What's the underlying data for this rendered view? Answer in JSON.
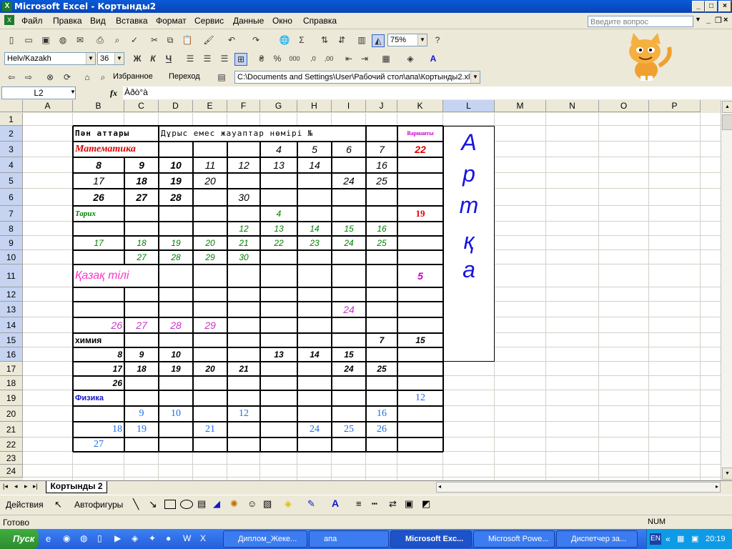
{
  "window": {
    "title": "Microsoft Excel - Кортынды2",
    "app_icon": "excel-icon"
  },
  "menu": [
    "Файл",
    "Правка",
    "Вид",
    "Вставка",
    "Формат",
    "Сервис",
    "Данные",
    "Окно",
    "Справка"
  ],
  "help_box": {
    "placeholder": "Введите вопрос"
  },
  "toolbar": {
    "zoom": "75%"
  },
  "format_toolbar": {
    "font": "Helv/Kazakh",
    "size": "36",
    "bold": "Ж",
    "italic": "К",
    "underline": "Ч"
  },
  "web_toolbar": {
    "favorites": "Избранное",
    "go": "Переход",
    "address": "C:\\Documents and Settings\\User\\Рабочий стол\\апа\\Кортынды2.xls"
  },
  "formula_bar": {
    "name_box": "L2",
    "fx": "fx",
    "content": "Àðò°à"
  },
  "columns": [
    "A",
    "B",
    "C",
    "D",
    "E",
    "F",
    "G",
    "H",
    "I",
    "J",
    "K",
    "L",
    "M",
    "N",
    "O",
    "P"
  ],
  "rows": [
    "1",
    "2",
    "3",
    "4",
    "5",
    "6",
    "7",
    "8",
    "9",
    "10",
    "11",
    "12",
    "13",
    "14",
    "15",
    "16",
    "17",
    "18",
    "19",
    "20",
    "21",
    "22",
    "23",
    "24"
  ],
  "cells": [
    {
      "r": 2,
      "c": "B",
      "t": "Пән аттары",
      "color": "#000000",
      "bold": true,
      "align": "left",
      "font": "mono",
      "size": 11
    },
    {
      "r": 2,
      "c": "D",
      "t": "Дұрыс емес жауаптар нөмірі №",
      "color": "#000000",
      "bold": false,
      "align": "left",
      "font": "mono",
      "size": 11
    },
    {
      "r": 2,
      "c": "K",
      "t": "Варианты",
      "color": "#cc00cc",
      "bold": true,
      "align": "center",
      "font": "serif",
      "size": 8
    },
    {
      "r": 3,
      "c": "B",
      "t": "Математика",
      "color": "#e00000",
      "bold": true,
      "align": "left",
      "font": "serif",
      "italic": true,
      "size": 14
    },
    {
      "r": 3,
      "c": "G",
      "t": "4",
      "color": "#000000",
      "align": "center",
      "italic": true,
      "size": 14
    },
    {
      "r": 3,
      "c": "H",
      "t": "5",
      "color": "#000000",
      "align": "center",
      "italic": true,
      "size": 14
    },
    {
      "r": 3,
      "c": "I",
      "t": "6",
      "color": "#000000",
      "align": "center",
      "italic": true,
      "size": 14
    },
    {
      "r": 3,
      "c": "J",
      "t": "7",
      "color": "#000000",
      "align": "center",
      "italic": true,
      "size": 14
    },
    {
      "r": 3,
      "c": "K",
      "t": "22",
      "color": "#e00000",
      "bold": true,
      "align": "center",
      "italic": true,
      "size": 14
    },
    {
      "r": 4,
      "c": "B",
      "t": "8",
      "color": "#000000",
      "bold": true,
      "align": "center",
      "italic": true,
      "size": 14
    },
    {
      "r": 4,
      "c": "C",
      "t": "9",
      "color": "#000000",
      "bold": true,
      "align": "center",
      "italic": true,
      "size": 14
    },
    {
      "r": 4,
      "c": "D",
      "t": "10",
      "color": "#000000",
      "bold": true,
      "align": "center",
      "italic": true,
      "size": 14
    },
    {
      "r": 4,
      "c": "E",
      "t": "11",
      "color": "#000000",
      "align": "center",
      "italic": true,
      "size": 14
    },
    {
      "r": 4,
      "c": "F",
      "t": "12",
      "color": "#000000",
      "align": "center",
      "italic": true,
      "size": 14
    },
    {
      "r": 4,
      "c": "G",
      "t": "13",
      "color": "#000000",
      "align": "center",
      "italic": true,
      "size": 14
    },
    {
      "r": 4,
      "c": "H",
      "t": "14",
      "color": "#000000",
      "align": "center",
      "italic": true,
      "size": 14
    },
    {
      "r": 4,
      "c": "J",
      "t": "16",
      "color": "#000000",
      "align": "center",
      "italic": true,
      "size": 14
    },
    {
      "r": 5,
      "c": "B",
      "t": "17",
      "color": "#000000",
      "align": "center",
      "italic": true,
      "size": 14
    },
    {
      "r": 5,
      "c": "C",
      "t": "18",
      "color": "#000000",
      "bold": true,
      "align": "center",
      "italic": true,
      "size": 14
    },
    {
      "r": 5,
      "c": "D",
      "t": "19",
      "color": "#000000",
      "bold": true,
      "align": "center",
      "italic": true,
      "size": 14
    },
    {
      "r": 5,
      "c": "E",
      "t": "20",
      "color": "#000000",
      "align": "center",
      "italic": true,
      "size": 14
    },
    {
      "r": 5,
      "c": "I",
      "t": "24",
      "color": "#000000",
      "align": "center",
      "italic": true,
      "size": 14
    },
    {
      "r": 5,
      "c": "J",
      "t": "25",
      "color": "#000000",
      "align": "center",
      "italic": true,
      "size": 14
    },
    {
      "r": 6,
      "c": "B",
      "t": "26",
      "color": "#000000",
      "bold": true,
      "align": "center",
      "italic": true,
      "size": 14
    },
    {
      "r": 6,
      "c": "C",
      "t": "27",
      "color": "#000000",
      "bold": true,
      "align": "center",
      "italic": true,
      "size": 14
    },
    {
      "r": 6,
      "c": "D",
      "t": "28",
      "color": "#000000",
      "bold": true,
      "align": "center",
      "italic": true,
      "size": 14
    },
    {
      "r": 6,
      "c": "F",
      "t": "30",
      "color": "#000000",
      "align": "center",
      "italic": true,
      "size": 14
    },
    {
      "r": 7,
      "c": "B",
      "t": "Тарих",
      "color": "#008000",
      "bold": true,
      "align": "left",
      "font": "serif",
      "italic": true,
      "size": 11
    },
    {
      "r": 7,
      "c": "G",
      "t": "4",
      "color": "#008000",
      "align": "center",
      "italic": true,
      "size": 12
    },
    {
      "r": 7,
      "c": "K",
      "t": "19",
      "color": "#e00000",
      "bold": true,
      "align": "center",
      "font": "serif",
      "size": 13
    },
    {
      "r": 8,
      "c": "F",
      "t": "12",
      "color": "#008000",
      "align": "center",
      "italic": true,
      "size": 12
    },
    {
      "r": 8,
      "c": "G",
      "t": "13",
      "color": "#008000",
      "align": "center",
      "italic": true,
      "size": 12
    },
    {
      "r": 8,
      "c": "H",
      "t": "14",
      "color": "#008000",
      "align": "center",
      "italic": true,
      "size": 12
    },
    {
      "r": 8,
      "c": "I",
      "t": "15",
      "color": "#008000",
      "align": "center",
      "italic": true,
      "size": 12
    },
    {
      "r": 8,
      "c": "J",
      "t": "16",
      "color": "#008000",
      "align": "center",
      "italic": true,
      "size": 12
    },
    {
      "r": 9,
      "c": "B",
      "t": "17",
      "color": "#008000",
      "align": "center",
      "italic": true,
      "size": 12
    },
    {
      "r": 9,
      "c": "C",
      "t": "18",
      "color": "#008000",
      "align": "center",
      "italic": true,
      "size": 12
    },
    {
      "r": 9,
      "c": "D",
      "t": "19",
      "color": "#008000",
      "align": "center",
      "italic": true,
      "size": 12
    },
    {
      "r": 9,
      "c": "E",
      "t": "20",
      "color": "#008000",
      "align": "center",
      "italic": true,
      "size": 12
    },
    {
      "r": 9,
      "c": "F",
      "t": "21",
      "color": "#008000",
      "align": "center",
      "italic": true,
      "size": 12
    },
    {
      "r": 9,
      "c": "G",
      "t": "22",
      "color": "#008000",
      "align": "center",
      "italic": true,
      "size": 12
    },
    {
      "r": 9,
      "c": "H",
      "t": "23",
      "color": "#008000",
      "align": "center",
      "italic": true,
      "size": 12
    },
    {
      "r": 9,
      "c": "I",
      "t": "24",
      "color": "#008000",
      "align": "center",
      "italic": true,
      "size": 12
    },
    {
      "r": 9,
      "c": "J",
      "t": "25",
      "color": "#008000",
      "align": "center",
      "italic": true,
      "size": 12
    },
    {
      "r": 10,
      "c": "C",
      "t": "27",
      "color": "#008000",
      "align": "center",
      "italic": true,
      "size": 12
    },
    {
      "r": 10,
      "c": "D",
      "t": "28",
      "color": "#008000",
      "align": "center",
      "italic": true,
      "size": 12
    },
    {
      "r": 10,
      "c": "E",
      "t": "29",
      "color": "#008000",
      "align": "center",
      "italic": true,
      "size": 12
    },
    {
      "r": 10,
      "c": "F",
      "t": "30",
      "color": "#008000",
      "align": "center",
      "italic": true,
      "size": 12
    },
    {
      "r": 11,
      "c": "B",
      "t": "Қазақ тілі",
      "color": "#ff33cc",
      "align": "left",
      "italic": true,
      "size": 16
    },
    {
      "r": 11,
      "c": "K",
      "t": "5",
      "color": "#cc00cc",
      "bold": true,
      "align": "center",
      "italic": true,
      "size": 14
    },
    {
      "r": 13,
      "c": "I",
      "t": "24",
      "color": "#cc33cc",
      "align": "center",
      "italic": true,
      "size": 14
    },
    {
      "r": 14,
      "c": "B",
      "t": "26",
      "color": "#cc33cc",
      "align": "right",
      "italic": true,
      "size": 14
    },
    {
      "r": 14,
      "c": "C",
      "t": "27",
      "color": "#cc33cc",
      "align": "center",
      "italic": true,
      "size": 14
    },
    {
      "r": 14,
      "c": "D",
      "t": "28",
      "color": "#cc33cc",
      "align": "center",
      "italic": true,
      "size": 14
    },
    {
      "r": 14,
      "c": "E",
      "t": "29",
      "color": "#cc33cc",
      "align": "center",
      "italic": true,
      "size": 14
    },
    {
      "r": 15,
      "c": "B",
      "t": "химия",
      "color": "#000000",
      "bold": true,
      "align": "left",
      "size": 12
    },
    {
      "r": 15,
      "c": "J",
      "t": "7",
      "color": "#000000",
      "bold": true,
      "align": "center",
      "italic": true,
      "size": 12
    },
    {
      "r": 15,
      "c": "K",
      "t": "15",
      "color": "#000000",
      "bold": true,
      "align": "center",
      "italic": true,
      "size": 12
    },
    {
      "r": 16,
      "c": "B",
      "t": "8",
      "color": "#000000",
      "bold": true,
      "align": "right",
      "italic": true,
      "size": 12
    },
    {
      "r": 16,
      "c": "C",
      "t": "9",
      "color": "#000000",
      "bold": true,
      "align": "center",
      "italic": true,
      "size": 12
    },
    {
      "r": 16,
      "c": "D",
      "t": "10",
      "color": "#000000",
      "bold": true,
      "align": "center",
      "italic": true,
      "size": 12
    },
    {
      "r": 16,
      "c": "G",
      "t": "13",
      "color": "#000000",
      "bold": true,
      "align": "center",
      "italic": true,
      "size": 12
    },
    {
      "r": 16,
      "c": "H",
      "t": "14",
      "color": "#000000",
      "bold": true,
      "align": "center",
      "italic": true,
      "size": 12
    },
    {
      "r": 16,
      "c": "I",
      "t": "15",
      "color": "#000000",
      "bold": true,
      "align": "center",
      "italic": true,
      "size": 12
    },
    {
      "r": 17,
      "c": "B",
      "t": "17",
      "color": "#000000",
      "bold": true,
      "align": "right",
      "italic": true,
      "size": 12
    },
    {
      "r": 17,
      "c": "C",
      "t": "18",
      "color": "#000000",
      "bold": true,
      "align": "center",
      "italic": true,
      "size": 12
    },
    {
      "r": 17,
      "c": "D",
      "t": "19",
      "color": "#000000",
      "bold": true,
      "align": "center",
      "italic": true,
      "size": 12
    },
    {
      "r": 17,
      "c": "E",
      "t": "20",
      "color": "#000000",
      "bold": true,
      "align": "center",
      "italic": true,
      "size": 12
    },
    {
      "r": 17,
      "c": "F",
      "t": "21",
      "color": "#000000",
      "bold": true,
      "align": "center",
      "italic": true,
      "size": 12
    },
    {
      "r": 17,
      "c": "I",
      "t": "24",
      "color": "#000000",
      "bold": true,
      "align": "center",
      "italic": true,
      "size": 12
    },
    {
      "r": 17,
      "c": "J",
      "t": "25",
      "color": "#000000",
      "bold": true,
      "align": "center",
      "italic": true,
      "size": 12
    },
    {
      "r": 18,
      "c": "B",
      "t": "26",
      "color": "#000000",
      "bold": true,
      "align": "right",
      "italic": true,
      "size": 12
    },
    {
      "r": 19,
      "c": "B",
      "t": "Физика",
      "color": "#1515cc",
      "bold": true,
      "align": "left",
      "size": 11
    },
    {
      "r": 19,
      "c": "K",
      "t": "12",
      "color": "#1e6ee6",
      "align": "center",
      "font": "serif",
      "size": 14
    },
    {
      "r": 20,
      "c": "C",
      "t": "9",
      "color": "#1e6ee6",
      "align": "center",
      "font": "serif",
      "size": 14
    },
    {
      "r": 20,
      "c": "D",
      "t": "10",
      "color": "#1e6ee6",
      "align": "center",
      "font": "serif",
      "size": 14
    },
    {
      "r": 20,
      "c": "F",
      "t": "12",
      "color": "#1e6ee6",
      "align": "center",
      "font": "serif",
      "size": 14
    },
    {
      "r": 20,
      "c": "J",
      "t": "16",
      "color": "#1e6ee6",
      "align": "center",
      "font": "serif",
      "size": 14
    },
    {
      "r": 21,
      "c": "B",
      "t": "18",
      "color": "#1e6ee6",
      "align": "right",
      "font": "serif",
      "size": 14
    },
    {
      "r": 21,
      "c": "C",
      "t": "19",
      "color": "#1e6ee6",
      "align": "center",
      "font": "serif",
      "size": 14
    },
    {
      "r": 21,
      "c": "E",
      "t": "21",
      "color": "#1e6ee6",
      "align": "center",
      "font": "serif",
      "size": 14
    },
    {
      "r": 21,
      "c": "H",
      "t": "24",
      "color": "#1e6ee6",
      "align": "center",
      "font": "serif",
      "size": 14
    },
    {
      "r": 21,
      "c": "I",
      "t": "25",
      "color": "#1e6ee6",
      "align": "center",
      "font": "serif",
      "size": 14
    },
    {
      "r": 21,
      "c": "J",
      "t": "26",
      "color": "#1e6ee6",
      "align": "center",
      "font": "serif",
      "size": 14
    },
    {
      "r": 22,
      "c": "B",
      "t": "27",
      "color": "#1e6ee6",
      "align": "center",
      "font": "serif",
      "size": 14
    }
  ],
  "textbox": {
    "letters": [
      "А",
      "р",
      "т",
      "қ",
      "а"
    ],
    "color": "#1515e0"
  },
  "sheet_tab": "Кортынды 2",
  "draw_toolbar": {
    "actions": "Действия",
    "autoshapes": "Автофигуры"
  },
  "status": {
    "ready": "Готово",
    "num": "NUM"
  },
  "taskbar": {
    "start": "Пуск",
    "tasks": [
      "Диплом_Жеке...",
      "апа",
      "Microsoft Exc...",
      "Microsoft Powe...",
      "Диспетчер за..."
    ],
    "lang": "EN",
    "clock": "20:19"
  }
}
